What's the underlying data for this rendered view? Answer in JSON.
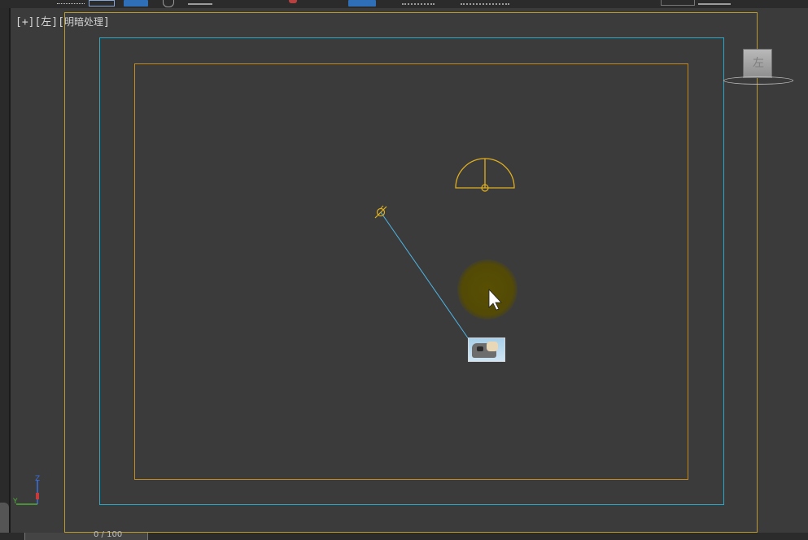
{
  "viewport": {
    "label_bracket": "[+][左][",
    "label_shading": "明暗处理",
    "label_close": "]"
  },
  "viewcube": {
    "face": "左"
  },
  "axis_gizmo": {
    "z": "Z",
    "y": "Y"
  },
  "timeline": {
    "frame_text": "0 / 100"
  },
  "icons": [
    "select-region-icon",
    "window-crossing-icon",
    "select-move-icon",
    "rotate-icon",
    "scale-icon",
    "snap-icon",
    "render-icon",
    "viewcube-icon",
    "axis-gizmo-icon",
    "target-light-icon",
    "hemisphere-light-icon",
    "cursor-icon"
  ],
  "colors": {
    "safe_frame_outer": "#b99a2a",
    "safe_frame_action": "#27a8c8",
    "safe_frame_title": "#c28a1f",
    "light_target_line": "#4fb6e6",
    "light_gizmo": "#e0b020",
    "cursor_halo": "#5a5000",
    "toolbar_active": "#2f6fb8"
  }
}
